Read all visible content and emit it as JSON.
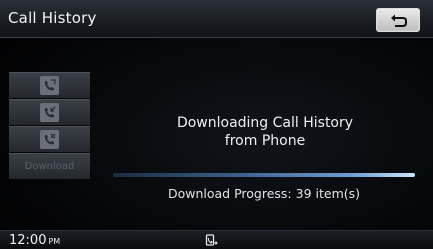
{
  "header": {
    "title": "Call History",
    "back_icon": "back-arrow-icon"
  },
  "sidebar": {
    "buttons": [
      {
        "icon": "outgoing-call-icon",
        "label": ""
      },
      {
        "icon": "incoming-call-icon",
        "label": ""
      },
      {
        "icon": "missed-call-icon",
        "label": ""
      },
      {
        "icon": "",
        "label": "Download"
      }
    ]
  },
  "main": {
    "message_line1": "Downloading Call History",
    "message_line2": "from Phone",
    "progress_text": "Download  Progress: 39 item(s)",
    "progress_fill_fraction": 1.0
  },
  "status": {
    "time": "12:00",
    "ampm": "PM",
    "phone_icon": "phone-connected-icon"
  },
  "colors": {
    "accent_blue": "#6fa0d6",
    "text": "#eef0f2",
    "disabled_text": "#5c6168"
  }
}
